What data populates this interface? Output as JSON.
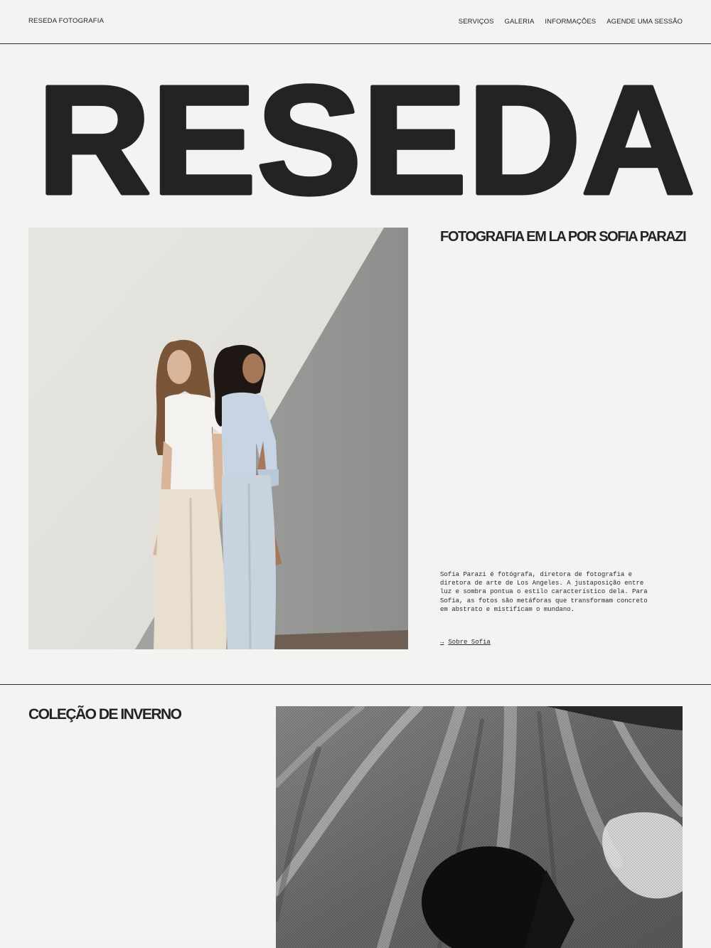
{
  "header": {
    "brand": "RESEDA FOTOGRAFIA",
    "nav": [
      {
        "label": "SERVIÇOS"
      },
      {
        "label": "GALERIA"
      },
      {
        "label": "INFORMAÇÕES"
      },
      {
        "label": "AGENDE UMA SESSÃO"
      }
    ]
  },
  "hero": {
    "wordmark": "RESEDA"
  },
  "intro": {
    "tagline": "FOTOGRAFIA EM LA POR SOFIA PARAZI",
    "bio": "Sofia Parazi é fotógrafa, diretora de fotografia e diretora de arte de Los Angeles. A justaposição entre luz e sombra pontua o estilo característico dela. Para Sofia, as fotos são metáforas que transformam concreto em abstrato e mistificam o mundano.",
    "link_arrow": "→",
    "link_label": "Sobre Sofia"
  },
  "collection": {
    "title": "COLEÇÃO DE INVERNO"
  },
  "icons": {
    "arrow": "arrow-right-icon"
  },
  "colors": {
    "background": "#f3f3f1",
    "ink": "#232325",
    "wall": "#e6e4df",
    "shadow": "#9a9a98"
  }
}
